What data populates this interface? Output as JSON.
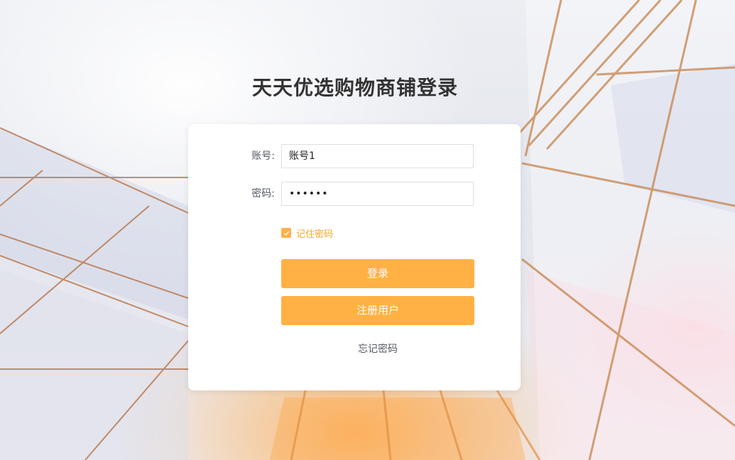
{
  "page": {
    "title": "天天优选购物商铺登录"
  },
  "form": {
    "account_label": "账号:",
    "account_value": "账号1",
    "password_label": "密码:",
    "password_value": "••••••",
    "remember_label": "记住密码",
    "remember_checked": true,
    "login_label": "登录",
    "register_label": "注册用户",
    "forgot_label": "忘记密码"
  },
  "colors": {
    "accent": "#ffb144",
    "remember_text": "#f5a623",
    "title": "#333333",
    "card": "#ffffff"
  },
  "icons": {
    "checkbox": "check-icon"
  }
}
